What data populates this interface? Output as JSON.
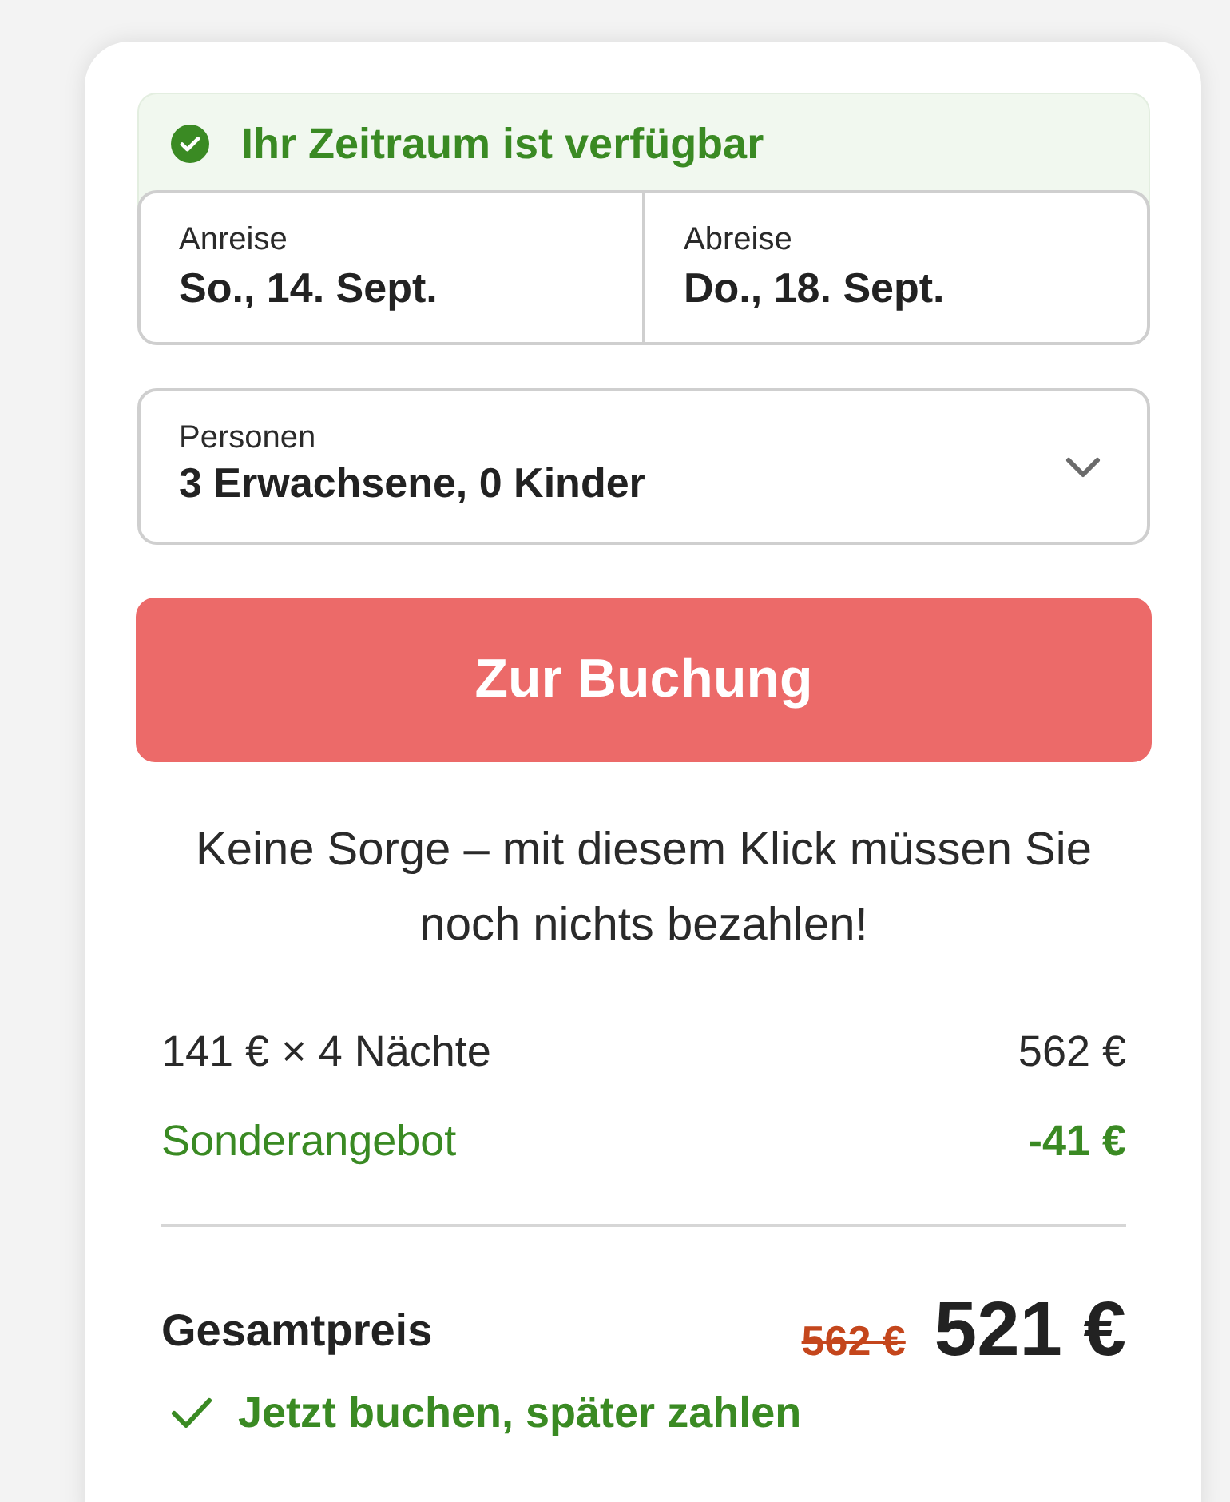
{
  "availability_banner": {
    "text": "Ihr Zeitraum ist verfügbar"
  },
  "dates": [
    {
      "label": "Anreise",
      "value": "So., 14. Sept."
    },
    {
      "label": "Abreise",
      "value": "Do., 18. Sept."
    }
  ],
  "guests": {
    "label": "Personen",
    "value": "3 Erwachsene, 0 Kinder"
  },
  "book_button": "Zur Buchung",
  "note": "Keine Sorge – mit diesem Klick müssen Sie noch nichts bezahlen!",
  "price_lines": [
    {
      "kind": "regular",
      "label": "141 € × 4 Nächte",
      "amount": "562 €"
    },
    {
      "kind": "discount",
      "label": "Sonderangebot",
      "amount": "-41 €"
    }
  ],
  "total": {
    "label": "Gesamtpreis",
    "old_price": "562 €",
    "price": "521 €"
  },
  "pay_later": "Jetzt buchen, später zahlen"
}
